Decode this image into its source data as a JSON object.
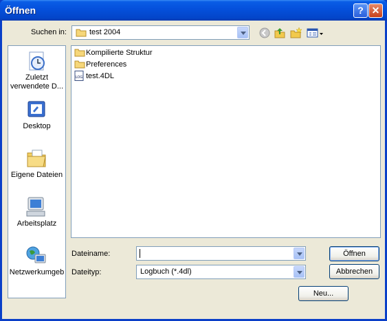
{
  "window": {
    "title": "Öffnen",
    "help_glyph": "?",
    "close_glyph": "✕"
  },
  "lookin": {
    "label": "Suchen in:",
    "value": "test 2004"
  },
  "places": [
    {
      "icon": "recent-documents-icon",
      "label_line1": "Zuletzt",
      "label_line2": "verwendete D..."
    },
    {
      "icon": "desktop-icon",
      "label_line1": "Desktop",
      "label_line2": ""
    },
    {
      "icon": "my-documents-icon",
      "label_line1": "Eigene Dateien",
      "label_line2": ""
    },
    {
      "icon": "my-computer-icon",
      "label_line1": "Arbeitsplatz",
      "label_line2": ""
    },
    {
      "icon": "network-places-icon",
      "label_line1": "Netzwerkumgeb",
      "label_line2": ""
    }
  ],
  "files": [
    {
      "name": "Kompilierte Struktur",
      "icon": "folder-icon"
    },
    {
      "name": "Preferences",
      "icon": "folder-icon"
    },
    {
      "name": "test.4DL",
      "icon": "log-file-icon"
    }
  ],
  "log_icon_text": "LOG",
  "filename": {
    "label": "Dateiname:",
    "value": ""
  },
  "filetype": {
    "label": "Dateityp:",
    "value": "Logbuch (*.4dl)"
  },
  "buttons": {
    "open": "Öffnen",
    "cancel": "Abbrechen",
    "new": "Neu..."
  }
}
